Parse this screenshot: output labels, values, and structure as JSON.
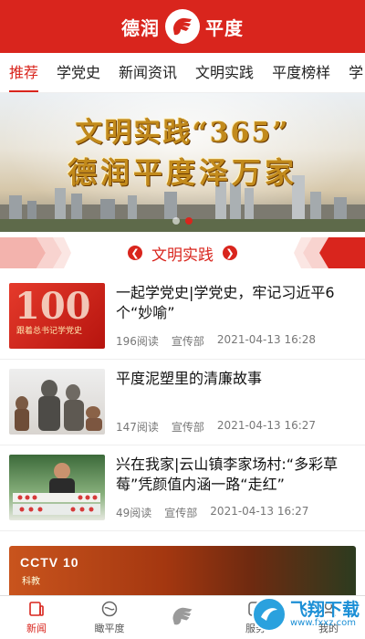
{
  "header": {
    "brand_left": "德润",
    "brand_right": "平度"
  },
  "tabs": [
    {
      "label": "推荐",
      "active": true
    },
    {
      "label": "学党史"
    },
    {
      "label": "新闻资讯"
    },
    {
      "label": "文明实践"
    },
    {
      "label": "平度榜样"
    },
    {
      "label": "学"
    }
  ],
  "banner": {
    "line1": "文明实践“365”",
    "line2": "德润平度泽万家",
    "dots": 2,
    "active_dot": 1
  },
  "section": {
    "title": "文明实践",
    "prev_icon": "chevron-left-icon",
    "next_icon": "chevron-right-icon"
  },
  "articles": [
    {
      "title": "一起学党史|学党史，牢记习近平6个“妙喻”",
      "reads": "196阅读",
      "dept": "宣传部",
      "time": "2021-04-13 16:28",
      "thumb_big": "100",
      "thumb_caption": "跟着总书记学党史"
    },
    {
      "title": "平度泥塑里的清廉故事",
      "reads": "147阅读",
      "dept": "宣传部",
      "time": "2021-04-13 16:27"
    },
    {
      "title": "兴在我家|云山镇李家场村:“多彩草莓”凭颜值内涵一路“走红”",
      "reads": "49阅读",
      "dept": "宣传部",
      "time": "2021-04-13 16:27"
    }
  ],
  "big_card": {
    "logo": "CCTV 10",
    "sub": "科教"
  },
  "bottom_nav": [
    {
      "label": "新闻",
      "icon": "news-icon",
      "active": true
    },
    {
      "label": "瞰平度",
      "icon": "globe-icon"
    },
    {
      "label": "",
      "icon": "hand-logo-icon"
    },
    {
      "label": "服务",
      "icon": "service-icon"
    },
    {
      "label": "我的",
      "icon": "profile-icon"
    }
  ],
  "watermark": {
    "main": "飞翔下载",
    "url": "www.fxxz.com"
  },
  "colors": {
    "brand_red": "#d9251d",
    "watermark_blue": "#1b8fd6"
  }
}
